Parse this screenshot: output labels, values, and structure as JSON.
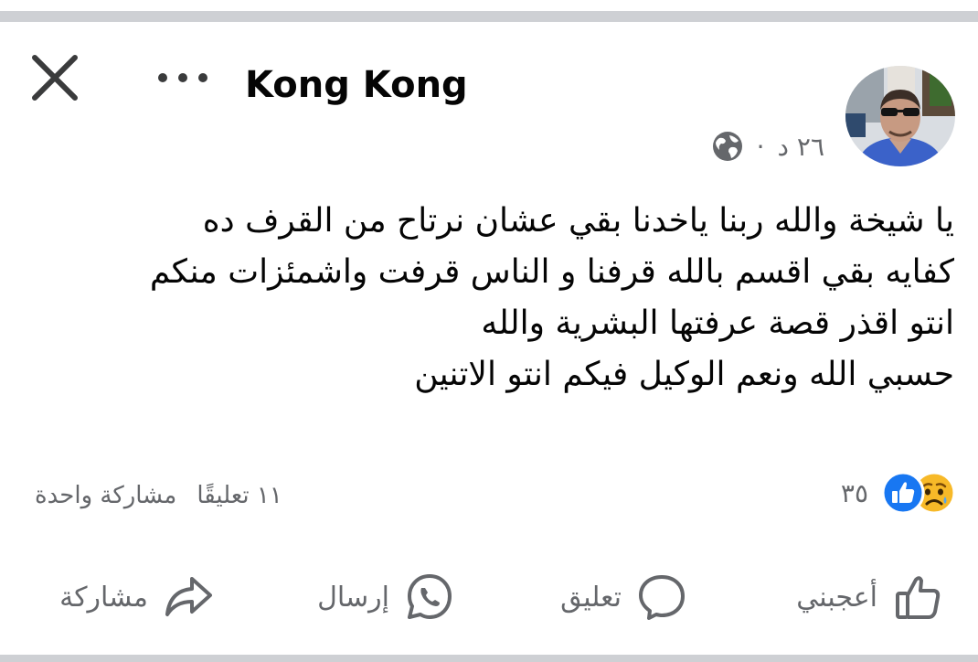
{
  "post": {
    "author": "Kong Kong",
    "time": "٢٦ د",
    "separator": "·",
    "lines": [
      "يا شيخة والله ربنا ياخدنا بقي عشان نرتاح من القرف ده",
      "كفايه بقي اقسم بالله قرفنا و الناس قرفت واشمئزات منكم",
      "انتو اقذر قصة عرفتها البشرية والله",
      "حسبي الله ونعم الوكيل فيكم انتو الاتنين"
    ]
  },
  "reactions": {
    "count": "٣٥",
    "types": [
      "sad-reaction-icon",
      "like-reaction-icon"
    ]
  },
  "stats": {
    "comments": "١١ تعليقًا",
    "shares": "مشاركة واحدة"
  },
  "actions": {
    "like": "أعجبني",
    "comment": "تعليق",
    "send": "إرسال",
    "share": "مشاركة"
  },
  "colors": {
    "like_blue": "#1877f2",
    "sad_yellow": "#f7b928",
    "muted_text": "#65676b",
    "divider": "#ced0d4"
  }
}
